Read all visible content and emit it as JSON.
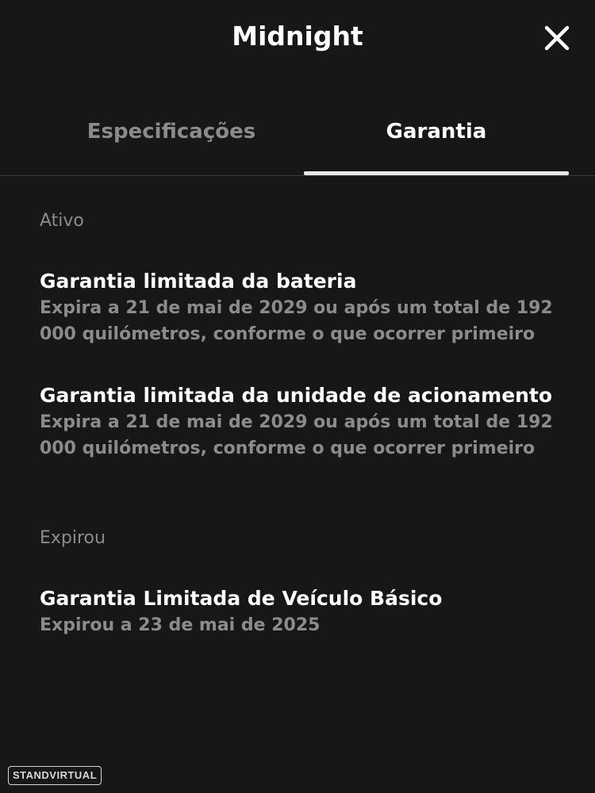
{
  "header": {
    "title": "Midnight",
    "close_icon": "close-icon"
  },
  "tabs": [
    {
      "label": "Especificações",
      "active": false
    },
    {
      "label": "Garantia",
      "active": true
    }
  ],
  "sections": [
    {
      "label": "Ativo",
      "items": [
        {
          "title": "Garantia limitada da bateria",
          "description": "Expira a 21 de mai de 2029 ou após um total de 192 000 quilómetros, conforme o que ocorrer primeiro"
        },
        {
          "title": "Garantia limitada da unidade de acionamento",
          "description": "Expira a 21 de mai de 2029 ou após um total de 192 000 quilómetros, conforme o que ocorrer primeiro"
        }
      ]
    },
    {
      "label": "Expirou",
      "items": [
        {
          "title": "Garantia Limitada de Veículo Básico",
          "description": "Expirou a 23 de mai de 2025"
        }
      ]
    }
  ],
  "watermark": "STANDVIRTUAL",
  "colors": {
    "background": "#171719",
    "primary_text": "#ffffff",
    "secondary_text": "#8b8b8d",
    "tab_indicator": "#e7e7e9",
    "divider": "#3a3a3d"
  }
}
